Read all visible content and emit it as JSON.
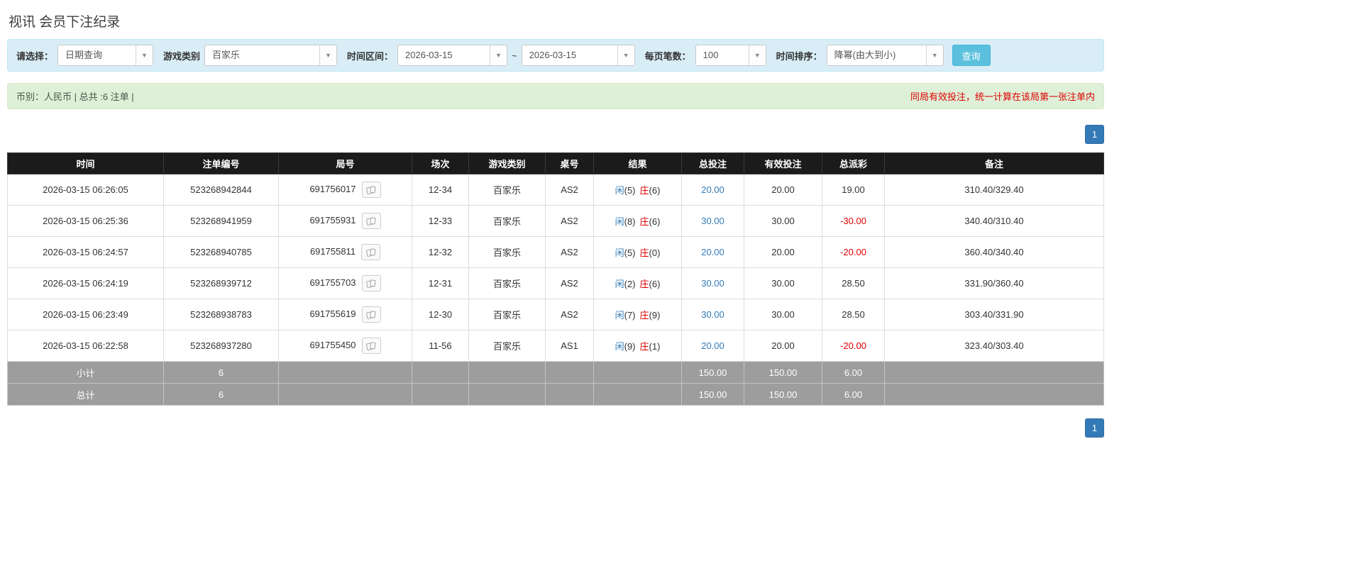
{
  "page": {
    "title": "视讯 会员下注纪录"
  },
  "filters": {
    "mode_label": "请选择：",
    "mode_value": "日期查询",
    "game_label": "游戏类别",
    "game_value": "百家乐",
    "range_label": "时间区间：",
    "date_from": "2026-03-15",
    "tilde": "~",
    "date_to": "2026-03-15",
    "page_size_label": "每页笔数：",
    "page_size_value": "100",
    "sort_label": "时间排序：",
    "sort_value": "降幂(由大到小)",
    "search_label": "查询"
  },
  "summary": {
    "currency_info": "币别：人民币 | 总共 :6 注单 |",
    "notice": "同局有效投注，统一计算在该局第一张注单内"
  },
  "pagination": {
    "page": "1"
  },
  "table": {
    "headers": {
      "time": "时间",
      "bet_id": "注单编号",
      "round": "局号",
      "session": "场次",
      "game": "游戏类别",
      "table_no": "桌号",
      "result": "结果",
      "total_bet": "总投注",
      "valid_bet": "有效投注",
      "payout": "总派彩",
      "remark": "备注"
    },
    "rows": [
      {
        "time": "2026-03-15 06:26:05",
        "bet_id": "523268942844",
        "round": "691756017",
        "session": "12-34",
        "game": "百家乐",
        "table_no": "AS2",
        "player": "闲",
        "player_score": "(5)",
        "banker": "庄",
        "banker_score": "(6)",
        "total_bet": "20.00",
        "valid_bet": "20.00",
        "payout": "19.00",
        "remark": "310.40/329.40"
      },
      {
        "time": "2026-03-15 06:25:36",
        "bet_id": "523268941959",
        "round": "691755931",
        "session": "12-33",
        "game": "百家乐",
        "table_no": "AS2",
        "player": "闲",
        "player_score": "(8)",
        "banker": "庄",
        "banker_score": "(6)",
        "total_bet": "30.00",
        "valid_bet": "30.00",
        "payout": "-30.00",
        "remark": "340.40/310.40"
      },
      {
        "time": "2026-03-15 06:24:57",
        "bet_id": "523268940785",
        "round": "691755811",
        "session": "12-32",
        "game": "百家乐",
        "table_no": "AS2",
        "player": "闲",
        "player_score": "(5)",
        "banker": "庄",
        "banker_score": "(0)",
        "total_bet": "20.00",
        "valid_bet": "20.00",
        "payout": "-20.00",
        "remark": "360.40/340.40"
      },
      {
        "time": "2026-03-15 06:24:19",
        "bet_id": "523268939712",
        "round": "691755703",
        "session": "12-31",
        "game": "百家乐",
        "table_no": "AS2",
        "player": "闲",
        "player_score": "(2)",
        "banker": "庄",
        "banker_score": "(6)",
        "total_bet": "30.00",
        "valid_bet": "30.00",
        "payout": "28.50",
        "remark": "331.90/360.40"
      },
      {
        "time": "2026-03-15 06:23:49",
        "bet_id": "523268938783",
        "round": "691755619",
        "session": "12-30",
        "game": "百家乐",
        "table_no": "AS2",
        "player": "闲",
        "player_score": "(7)",
        "banker": "庄",
        "banker_score": "(9)",
        "total_bet": "30.00",
        "valid_bet": "30.00",
        "payout": "28.50",
        "remark": "303.40/331.90"
      },
      {
        "time": "2026-03-15 06:22:58",
        "bet_id": "523268937280",
        "round": "691755450",
        "session": "11-56",
        "game": "百家乐",
        "table_no": "AS1",
        "player": "闲",
        "player_score": "(9)",
        "banker": "庄",
        "banker_score": "(1)",
        "total_bet": "20.00",
        "valid_bet": "20.00",
        "payout": "-20.00",
        "remark": "323.40/303.40"
      }
    ],
    "subtotal": {
      "label": "小计",
      "count": "6",
      "total_bet": "150.00",
      "valid_bet": "150.00",
      "payout": "6.00"
    },
    "grand_total": {
      "label": "总计",
      "count": "6",
      "total_bet": "150.00",
      "valid_bet": "150.00",
      "payout": "6.00"
    }
  },
  "icons": {
    "combo_caret": "caret-down-icon",
    "round_result": "cards-icon"
  },
  "colors": {
    "player_blue": "#337ab7",
    "banker_red": "#dd0000",
    "negative_red": "#dd0000",
    "bet_link_blue": "#337ab7",
    "notice_red": "#dd0000",
    "search_button_bg": "#5bc0de",
    "pager_bg": "#337ab7",
    "table_header_bg": "#1b1b1b",
    "table_footer_bg": "#9d9d9d",
    "filter_bar_bg": "#d9edf7",
    "summary_bar_bg": "#dff0d8"
  }
}
